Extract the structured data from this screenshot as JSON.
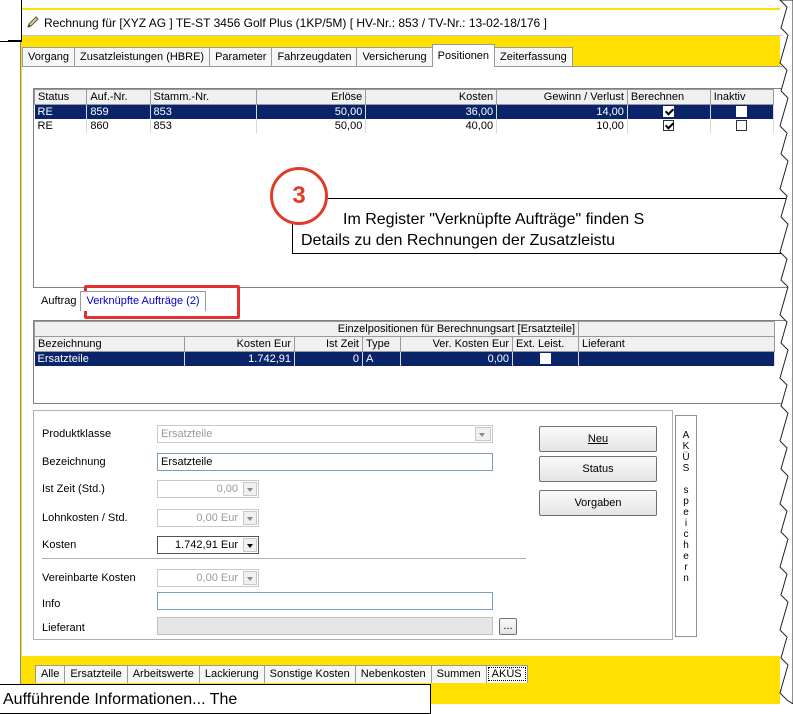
{
  "window": {
    "title": "Rechnung für [XYZ AG ] TE-ST 3456 Golf Plus (1KP/5M) [ HV-Nr.: 853 / TV-Nr.: 13-02-18/176 ]"
  },
  "top_tabs": [
    "Vorgang",
    "Zusatzleistungen (HBRE)",
    "Parameter",
    "Fahrzeugdaten",
    "Versicherung",
    "Positionen",
    "Zeiterfassung"
  ],
  "active_top_tab": "Positionen",
  "grid1": {
    "headers": [
      "Status",
      "Auf.-Nr.",
      "Stamm.-Nr.",
      "Erlöse",
      "Kosten",
      "Gewinn / Verlust",
      "Berechnen",
      "Inaktiv"
    ],
    "rows": [
      {
        "status": "RE",
        "auf": "859",
        "stamm": "853",
        "erloese": "50,00",
        "kosten": "36,00",
        "gewinn": "14,00",
        "berechnen": true,
        "inaktiv": false
      },
      {
        "status": "RE",
        "auf": "860",
        "stamm": "853",
        "erloese": "50,00",
        "kosten": "40,00",
        "gewinn": "10,00",
        "berechnen": true,
        "inaktiv": false
      }
    ]
  },
  "callout": {
    "number": "3",
    "line1": "Im Register \"Verknüpfte Aufträge\" finden S",
    "line2": "Details zu den Rechnungen der Zusatzleistu"
  },
  "sub_tabs": [
    "Auftrag",
    "Verknüpfte Aufträge (2)"
  ],
  "grid2": {
    "caption": "Einzelpositionen für Berechnungsart [Ersatzteile]",
    "headers": [
      "Bezeichnung",
      "Kosten Eur",
      "Ist Zeit",
      "Type",
      "Ver. Kosten Eur",
      "Ext. Leist.",
      "Lieferant"
    ],
    "rows": [
      {
        "bez": "Ersatzteile",
        "kosten": "1.742,91",
        "zeit": "0",
        "type": "A",
        "ver": "0,00",
        "ext": false,
        "lief": ""
      }
    ]
  },
  "form": {
    "produktklasse_label": "Produktklasse",
    "produktklasse": "Ersatzteile",
    "bezeichnung_label": "Bezeichnung",
    "bezeichnung": "Ersatzteile",
    "istzeit_label": "Ist Zeit (Std.)",
    "istzeit": "0,00",
    "lohnkosten_label": "Lohnkosten / Std.",
    "lohnkosten": "0,00 Eur",
    "kosten_label": "Kosten",
    "kosten": "1.742,91 Eur",
    "vereinbart_label": "Vereinbarte Kosten",
    "vereinbart": "0,00 Eur",
    "info_label": "Info",
    "info": "",
    "lieferant_label": "Lieferant",
    "lieferant": "",
    "browse": "...",
    "btn_neu": "Neu",
    "btn_status": "Status",
    "btn_vorgaben": "Vorgaben",
    "akus_letters": [
      "A",
      "K",
      "Ü",
      "S",
      "",
      "s",
      "p",
      "e",
      "i",
      "c",
      "h",
      "e",
      "r",
      "n"
    ]
  },
  "bottom_tabs": [
    "Alle",
    "Ersatzteile",
    "Arbeitswerte",
    "Lackierung",
    "Sonstige Kosten",
    "Nebenkosten",
    "Summen",
    "AKÜS"
  ],
  "active_bottom_tab": "AKÜS",
  "bottom_callout": "Aufführende Informationen... The",
  "colors": {
    "yellow": "#ffe000",
    "selection": "#0a246a",
    "callout_red": "#e03c2c"
  }
}
